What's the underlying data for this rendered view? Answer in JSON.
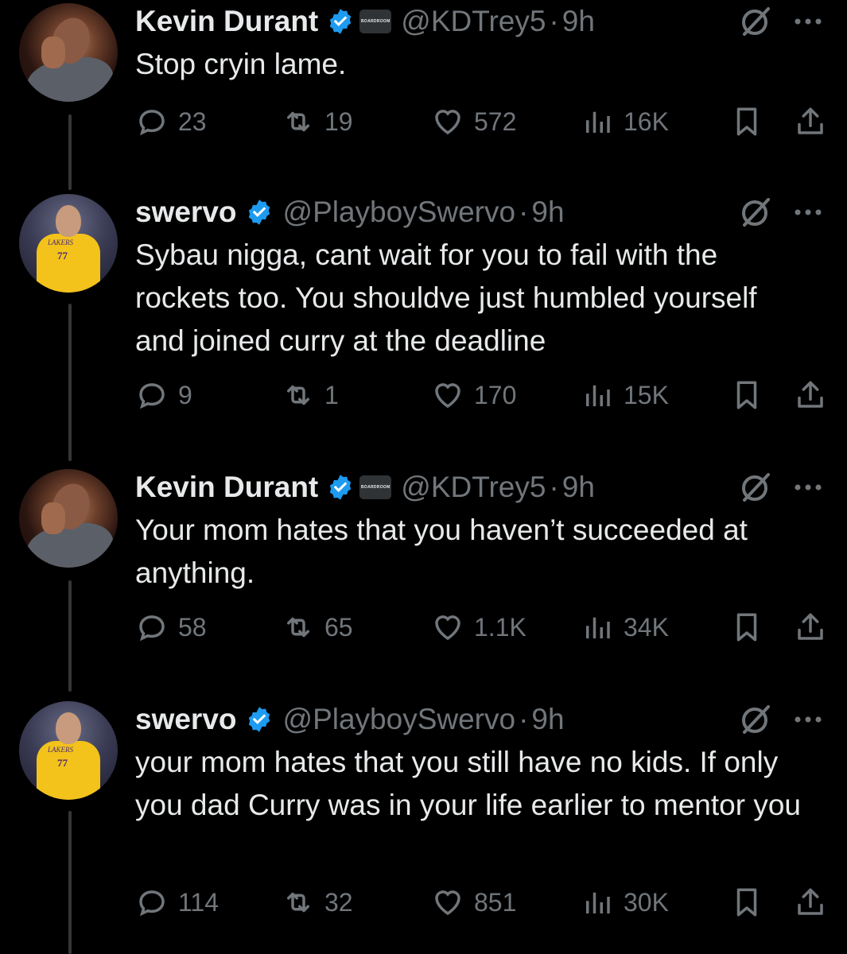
{
  "tweets": [
    {
      "name": "Kevin Durant",
      "handle": "@KDTrey5",
      "time": "9h",
      "affiliate": "BOARDROOM",
      "text": "Stop cryin lame.",
      "replies": "23",
      "retweets": "19",
      "likes": "572",
      "views": "16K"
    },
    {
      "name": "swervo",
      "handle": "@PlayboySwervo",
      "time": "9h",
      "text": "Sybau nigga, cant wait for you to fail with the rockets too. You shouldve just humbled yourself and joined curry at the deadline",
      "replies": "9",
      "retweets": "1",
      "likes": "170",
      "views": "15K"
    },
    {
      "name": "Kevin Durant",
      "handle": "@KDTrey5",
      "time": "9h",
      "affiliate": "BOARDROOM",
      "text": "Your mom hates that you haven’t succeeded at anything.",
      "replies": "58",
      "retweets": "65",
      "likes": "1.1K",
      "views": "34K"
    },
    {
      "name": "swervo",
      "handle": "@PlayboySwervo",
      "time": "9h",
      "text": "your mom hates that you still have no kids. If only you dad Curry was in your life earlier to mentor you",
      "replies": "114",
      "retweets": "32",
      "likes": "851",
      "views": "30K"
    }
  ],
  "avatar_labels": {
    "jersey_team": "LAKERS",
    "jersey_number": "77"
  },
  "colors": {
    "background": "#000000",
    "text": "#e7e9ea",
    "muted": "#71767b",
    "verified": "#1d9bf0",
    "thread_line": "#333639"
  },
  "icons": [
    "reply-icon",
    "retweet-icon",
    "like-icon",
    "views-icon",
    "bookmark-icon",
    "share-icon",
    "grok-icon",
    "more-icon",
    "verified-icon"
  ]
}
